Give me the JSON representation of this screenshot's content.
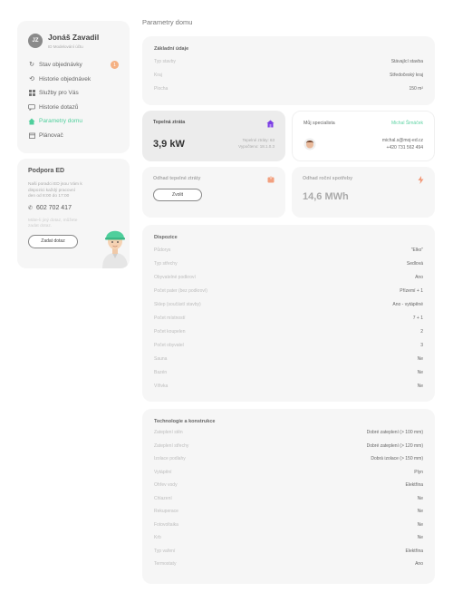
{
  "user": {
    "initials": "JZ",
    "name": "Jonáš Zavadil",
    "subtitle": "ID Modelování účtu"
  },
  "nav": [
    {
      "label": "Stav objednávky",
      "icon": "refresh-icon",
      "badge": "1"
    },
    {
      "label": "Historie objednávek",
      "icon": "history-icon"
    },
    {
      "label": "Služby pro Vás",
      "icon": "grid-icon"
    },
    {
      "label": "Historie dotazů",
      "icon": "chat-icon"
    },
    {
      "label": "Parametry domu",
      "icon": "home-icon",
      "active": true
    },
    {
      "label": "Plánovač",
      "icon": "calendar-icon"
    }
  ],
  "support": {
    "title": "Podpora ED",
    "text": "Naši poradci ED jsou Vám k dispozici každý pracovní den od 8:00 do 17:00",
    "phone": "602 702 417",
    "text2": "Máte-li jiný dotaz, můžete zadat dotaz.",
    "button": "Zadat dotaz"
  },
  "page_title": "Parametry domu",
  "basic": {
    "title": "Základní údaje",
    "rows": [
      {
        "k": "Typ stavby",
        "v": "Stávající stavba"
      },
      {
        "k": "Kraj",
        "v": "Středočeský kraj"
      },
      {
        "k": "Plocha",
        "v": "150 m²"
      }
    ]
  },
  "heat_loss": {
    "title": "Tepelná ztráta",
    "value": "3,9 kW",
    "note1": "Tepelné ztráty: 63",
    "note2": "Vypočteno: 18.1.0.3"
  },
  "specialist": {
    "title": "Můj specialista",
    "name": "Michal Šimáček",
    "email": "michal.s@moj-ed.cz",
    "phone": "+420 731 562 494"
  },
  "heating_estimate": {
    "title": "Odhad tepelné ztráty",
    "button": "Zvolit"
  },
  "consumption": {
    "title": "Odhad roční spotřeby",
    "value": "14,6 MWh"
  },
  "disposition": {
    "title": "Dispozice",
    "rows": [
      {
        "k": "Půdorys",
        "v": "\"Elko\""
      },
      {
        "k": "Typ střechy",
        "v": "Sedlová"
      },
      {
        "k": "Obyvatelné podkroví",
        "v": "Ano"
      },
      {
        "k": "Počet pater (bez podkroví)",
        "v": "Přízemí + 1"
      },
      {
        "k": "Sklep (součástí stavby)",
        "v": "Ano - vytápěné"
      },
      {
        "k": "Počet místností",
        "v": "7 + 1"
      },
      {
        "k": "Počet koupelen",
        "v": "2"
      },
      {
        "k": "Počet obyvatel",
        "v": "3"
      },
      {
        "k": "Sauna",
        "v": "Ne"
      },
      {
        "k": "Bazén",
        "v": "Ne"
      },
      {
        "k": "Vířivka",
        "v": "Ne"
      }
    ]
  },
  "technology": {
    "title": "Technologie a konstrukce",
    "rows": [
      {
        "k": "Zateplení stěn",
        "v": "Dobré zateplení (> 100 mm)"
      },
      {
        "k": "Zateplení střechy",
        "v": "Dobré zateplení (> 120 mm)"
      },
      {
        "k": "Izolace podlahy",
        "v": "Dobrá izolace (> 150 mm)"
      },
      {
        "k": "Vytápění",
        "v": "Plyn"
      },
      {
        "k": "Ohřev vody",
        "v": "Elektřina"
      },
      {
        "k": "Chlazení",
        "v": "Ne"
      },
      {
        "k": "Rekuperace",
        "v": "Ne"
      },
      {
        "k": "Fotovoltaika",
        "v": "Ne"
      },
      {
        "k": "Krb",
        "v": "Ne"
      },
      {
        "k": "Typ vaření",
        "v": "Elektřina"
      },
      {
        "k": "Termostaty",
        "v": "Ano"
      }
    ]
  },
  "colors": {
    "accent": "#4fcf9c",
    "badge": "#f5b183",
    "home": "#7b3fe4",
    "orange": "#f29a7a"
  }
}
